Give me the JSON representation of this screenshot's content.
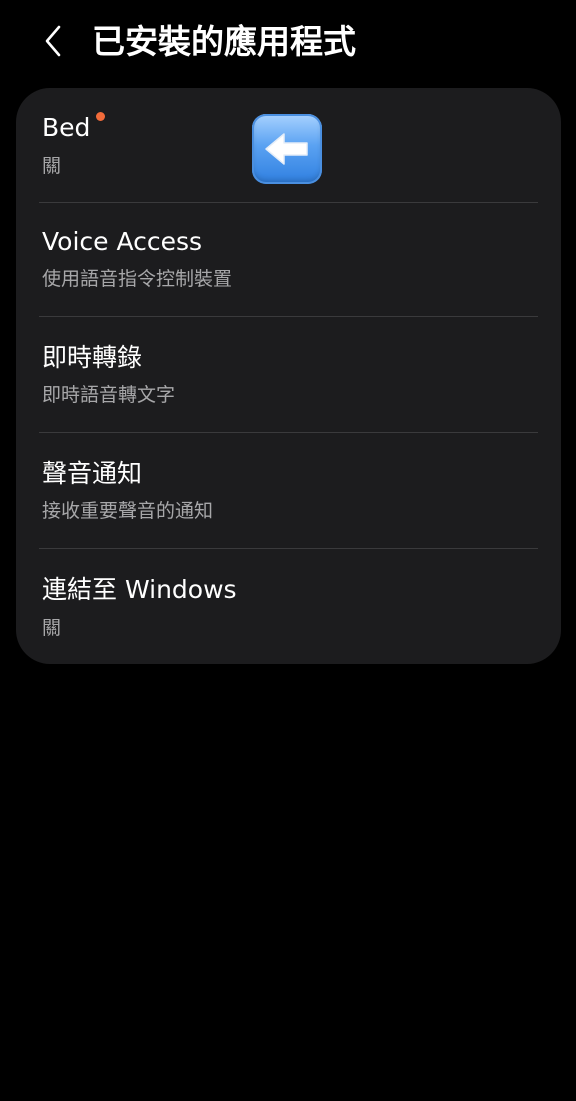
{
  "header": {
    "title": "已安裝的應用程式",
    "back_icon": "chevron-left-icon"
  },
  "apps": [
    {
      "title": "Bed",
      "subtitle": "關",
      "has_notification_dot": true
    },
    {
      "title": "Voice Access",
      "subtitle": "使用語音指令控制裝置"
    },
    {
      "title": "即時轉錄",
      "subtitle": "即時語音轉文字"
    },
    {
      "title": "聲音通知",
      "subtitle": "接收重要聲音的通知"
    },
    {
      "title": "連結至 Windows",
      "subtitle": "關"
    }
  ],
  "overlay_icon": "left-arrow-emoji-icon",
  "colors": {
    "background": "#000000",
    "card": "#1c1c1e",
    "divider": "#3a3a3c",
    "subtitle": "#a7a7a9",
    "notification_dot": "#f26b3a"
  }
}
